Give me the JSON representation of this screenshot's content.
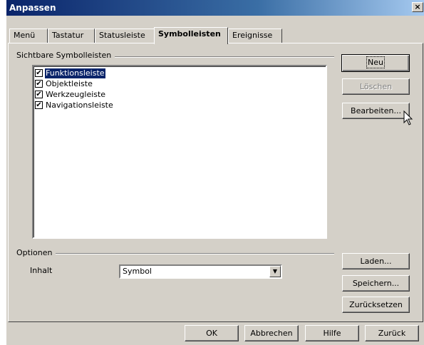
{
  "window": {
    "title": "Anpassen",
    "close_glyph": "×"
  },
  "tabs": [
    {
      "label": "Menü"
    },
    {
      "label": "Tastatur"
    },
    {
      "label": "Statusleiste"
    },
    {
      "label": "Symbolleisten",
      "active": true
    },
    {
      "label": "Ereignisse"
    }
  ],
  "toolbars_group": {
    "label": "Sichtbare Symbolleisten",
    "items": [
      {
        "label": "Funktionsleiste",
        "checked": true,
        "selected": true
      },
      {
        "label": "Objektleiste",
        "checked": true
      },
      {
        "label": "Werkzeugleiste",
        "checked": true
      },
      {
        "label": "Navigationsleiste",
        "checked": true
      }
    ]
  },
  "side_buttons": {
    "new": "Neu",
    "delete": "Löschen",
    "edit": "Bearbeiten...",
    "load": "Laden...",
    "save": "Speichern...",
    "reset": "Zurücksetzen"
  },
  "options_group": {
    "label": "Optionen",
    "content_label": "Inhalt",
    "content_value": "Symbol"
  },
  "footer_buttons": {
    "ok": "OK",
    "cancel": "Abbrechen",
    "help": "Hilfe",
    "back": "Zurück"
  },
  "icons": {
    "checkbox": "check-icon",
    "dropdown": "chevron-down-icon",
    "close": "close-icon",
    "cursor": "mouse-cursor-icon"
  },
  "colors": {
    "titlebar": "#0a246a",
    "dialog_bg": "#d4d0c8",
    "selection": "#0a246a"
  }
}
